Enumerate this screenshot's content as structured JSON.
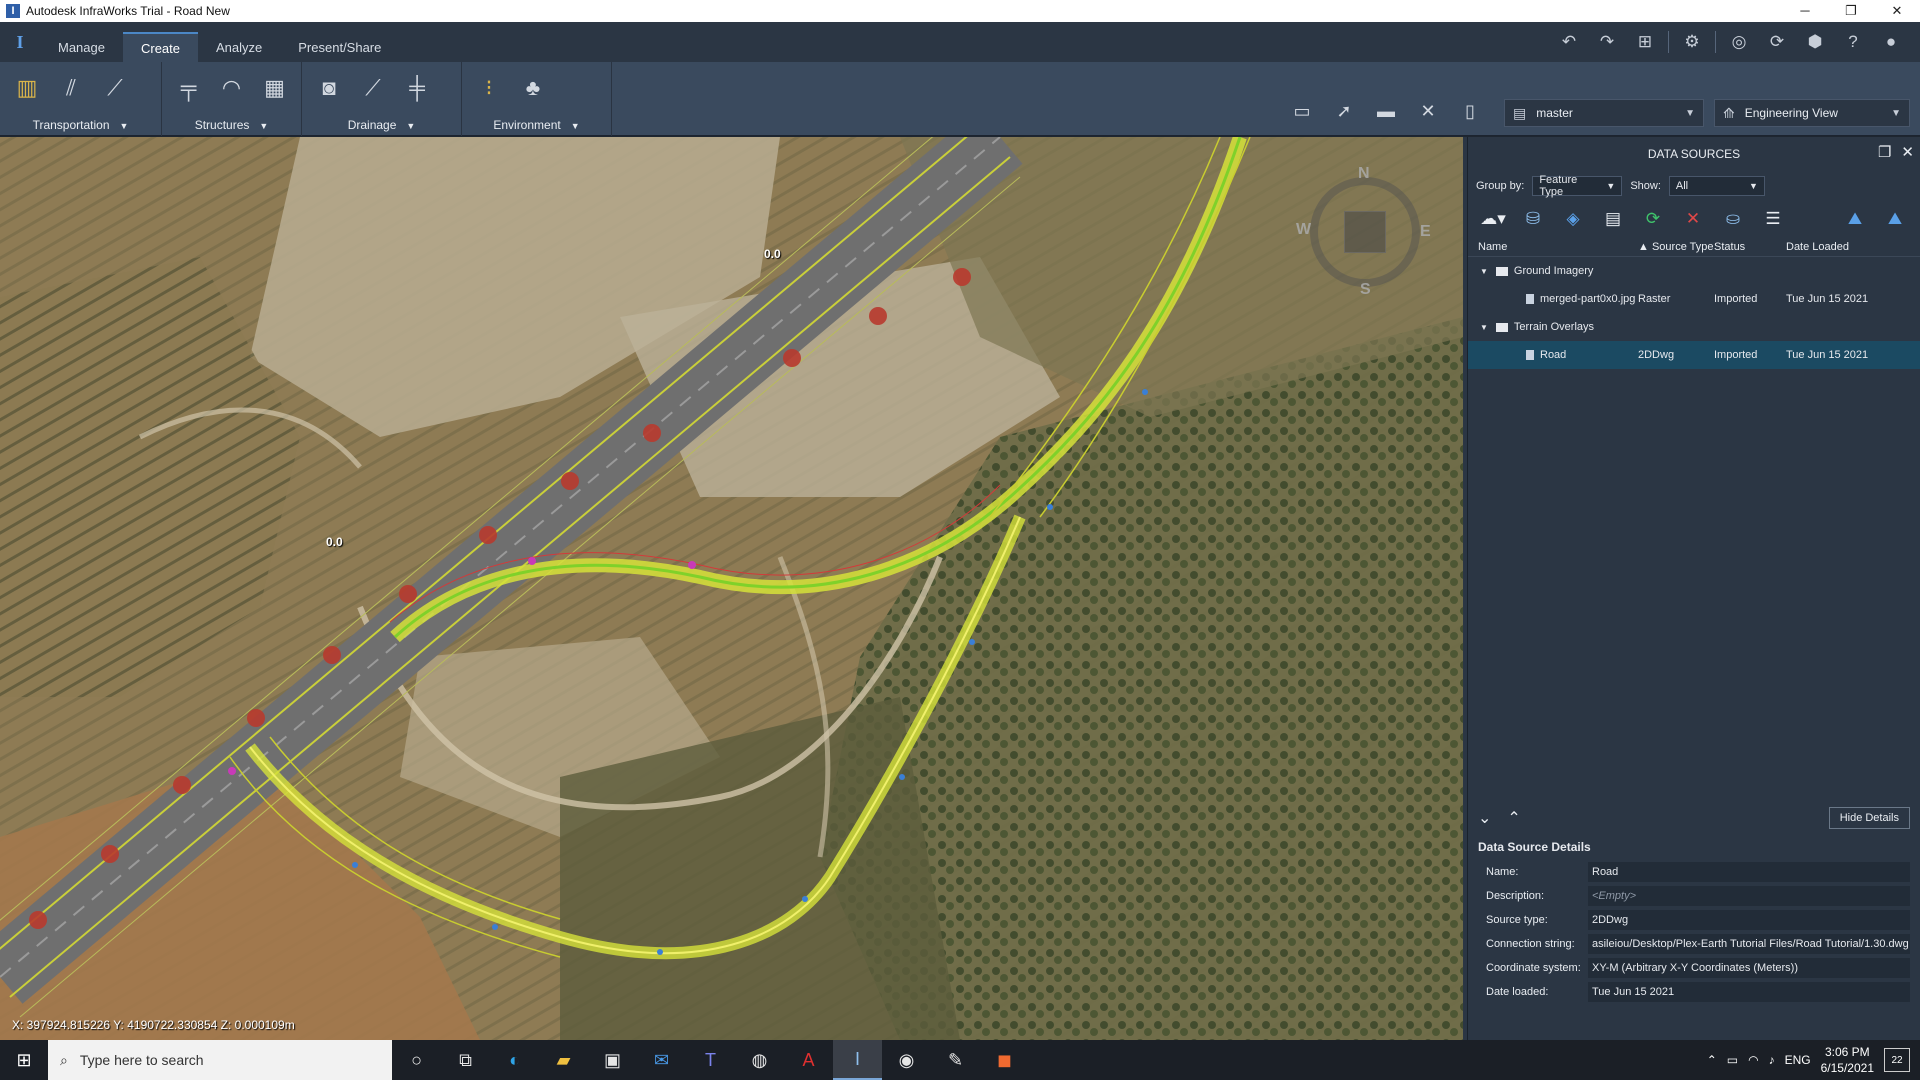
{
  "window": {
    "title": "Autodesk InfraWorks Trial - Road New",
    "controls": {
      "minimize": "─",
      "restore": "❐",
      "close": "✕"
    }
  },
  "ribbon_tabs": [
    {
      "label": "Manage",
      "active": false
    },
    {
      "label": "Create",
      "active": true
    },
    {
      "label": "Analyze",
      "active": false
    },
    {
      "label": "Present/Share",
      "active": false
    }
  ],
  "ribbon_groups": [
    {
      "label": "Transportation",
      "icons": [
        "road-icon",
        "curve-road-icon",
        "component-road-icon"
      ]
    },
    {
      "label": "Structures",
      "icons": [
        "bridge-icon",
        "tunnel-icon",
        "building-icon"
      ]
    },
    {
      "label": "Drainage",
      "icons": [
        "pipe-icon",
        "culvert-icon",
        "connector-icon"
      ]
    },
    {
      "label": "Environment",
      "icons": [
        "traffic-light-icon",
        "tree-icon"
      ]
    }
  ],
  "toolbar_right": {
    "proposal": "master",
    "view": "Engineering View"
  },
  "viewport": {
    "coordinates": "X: 397924.815226 Y: 4190722.330854 Z: 0.000109m",
    "road_labels": [
      "0.0",
      "0.0"
    ],
    "compass": {
      "n": "N",
      "s": "S",
      "e": "E",
      "w": "W"
    }
  },
  "data_sources": {
    "title": "DATA SOURCES",
    "group_by_label": "Group by:",
    "group_by_value": "Feature Type",
    "show_label": "Show:",
    "show_value": "All",
    "columns": [
      "Name",
      "Source Type",
      "Status",
      "Date Loaded"
    ],
    "groups": [
      {
        "name": "Ground Imagery",
        "items": [
          {
            "name": "merged-part0x0.jpg",
            "type": "Raster",
            "status": "Imported",
            "date": "Tue Jun 15 2021",
            "selected": false
          }
        ]
      },
      {
        "name": "Terrain Overlays",
        "items": [
          {
            "name": "Road",
            "type": "2DDwg",
            "status": "Imported",
            "date": "Tue Jun 15 2021",
            "selected": true
          }
        ]
      }
    ],
    "hide_details": "Hide Details",
    "details_title": "Data Source Details",
    "details": [
      {
        "key": "Name:",
        "value": "Road"
      },
      {
        "key": "Description:",
        "value": "<Empty>"
      },
      {
        "key": "Source type:",
        "value": "2DDwg"
      },
      {
        "key": "Connection string:",
        "value": "asileiou/Desktop/Plex-Earth Tutorial Files/Road Tutorial/1.30.dwg"
      },
      {
        "key": "Coordinate system:",
        "value": "XY-M (Arbitrary X-Y Coordinates (Meters))"
      },
      {
        "key": "Date loaded:",
        "value": "Tue Jun 15 2021"
      }
    ]
  },
  "taskbar": {
    "search_placeholder": "Type here to search",
    "language": "ENG",
    "time": "3:06 PM",
    "date": "6/15/2021",
    "notifications": "22"
  }
}
